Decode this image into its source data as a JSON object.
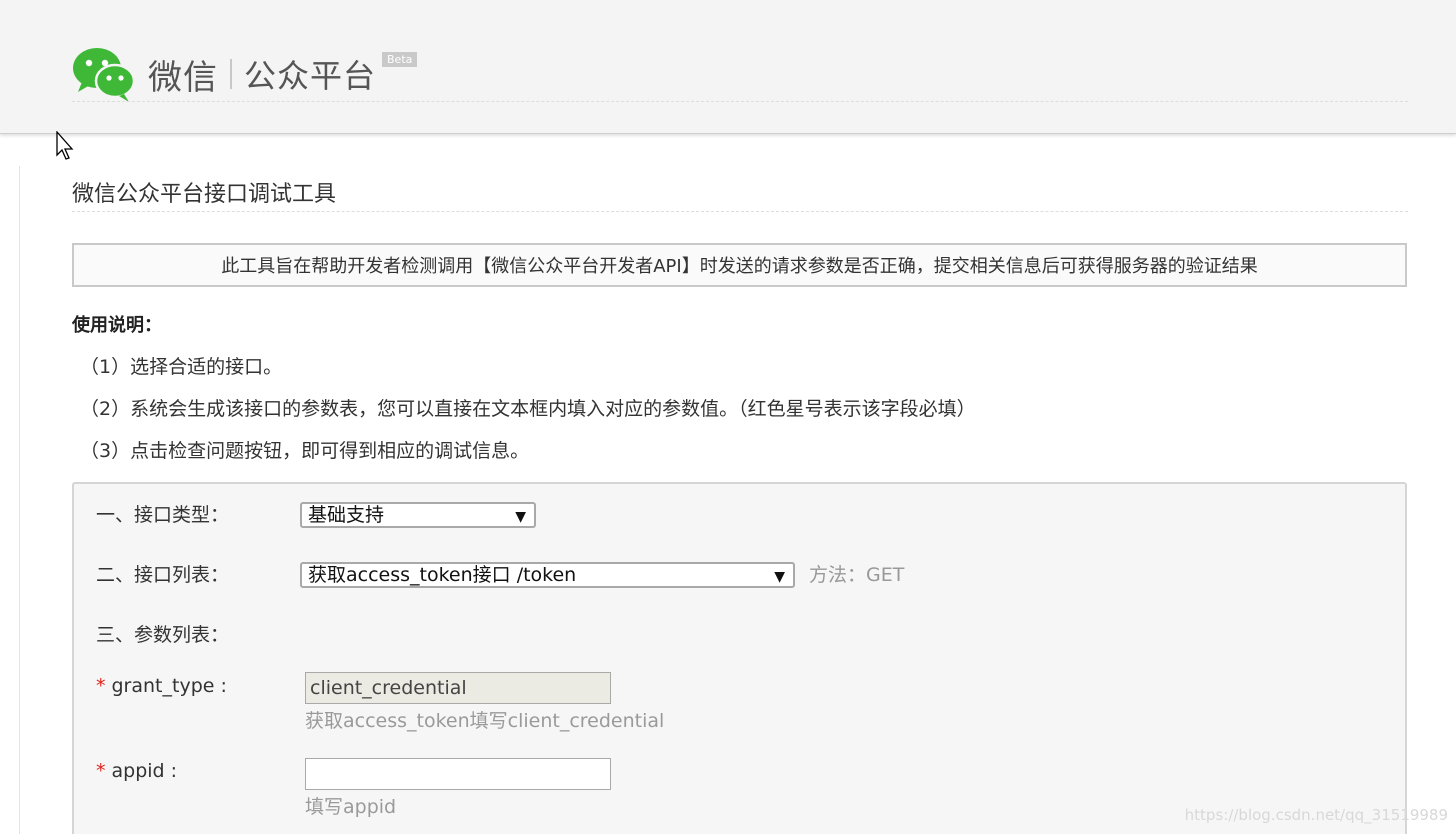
{
  "header": {
    "brand": "微信",
    "platform": "公众平台",
    "badge": "Beta"
  },
  "page": {
    "title": "微信公众平台接口调试工具",
    "notice": "此工具旨在帮助开发者检测调用【微信公众平台开发者API】时发送的请求参数是否正确，提交相关信息后可获得服务器的验证结果"
  },
  "usage": {
    "title": "使用说明：",
    "steps": [
      "（1）选择合适的接口。",
      "（2）系统会生成该接口的参数表，您可以直接在文本框内填入对应的参数值。（红色星号表示该字段必填）",
      "（3）点击检查问题按钮，即可得到相应的调试信息。"
    ]
  },
  "form": {
    "interface_type_label": "一、接口类型：",
    "interface_type_value": "基础支持",
    "interface_list_label": "二、接口列表：",
    "interface_list_value": "获取access_token接口 /token",
    "method": "方法：GET",
    "params_label": "三、参数列表：",
    "params": [
      {
        "required_mark": "*",
        "name": "grant_type :",
        "value": "client_credential",
        "readonly": true,
        "hint": "获取access_token填写client_credential"
      },
      {
        "required_mark": "*",
        "name": "appid :",
        "value": "",
        "readonly": false,
        "hint": "填写appid"
      }
    ]
  },
  "watermark": "https://blog.csdn.net/qq_31519989",
  "colors": {
    "wechat_green": "#3fb838",
    "required_red": "#e2231a"
  },
  "icons": [
    "wechat-logo-icon",
    "mouse-cursor-icon",
    "dropdown-caret-icon"
  ]
}
